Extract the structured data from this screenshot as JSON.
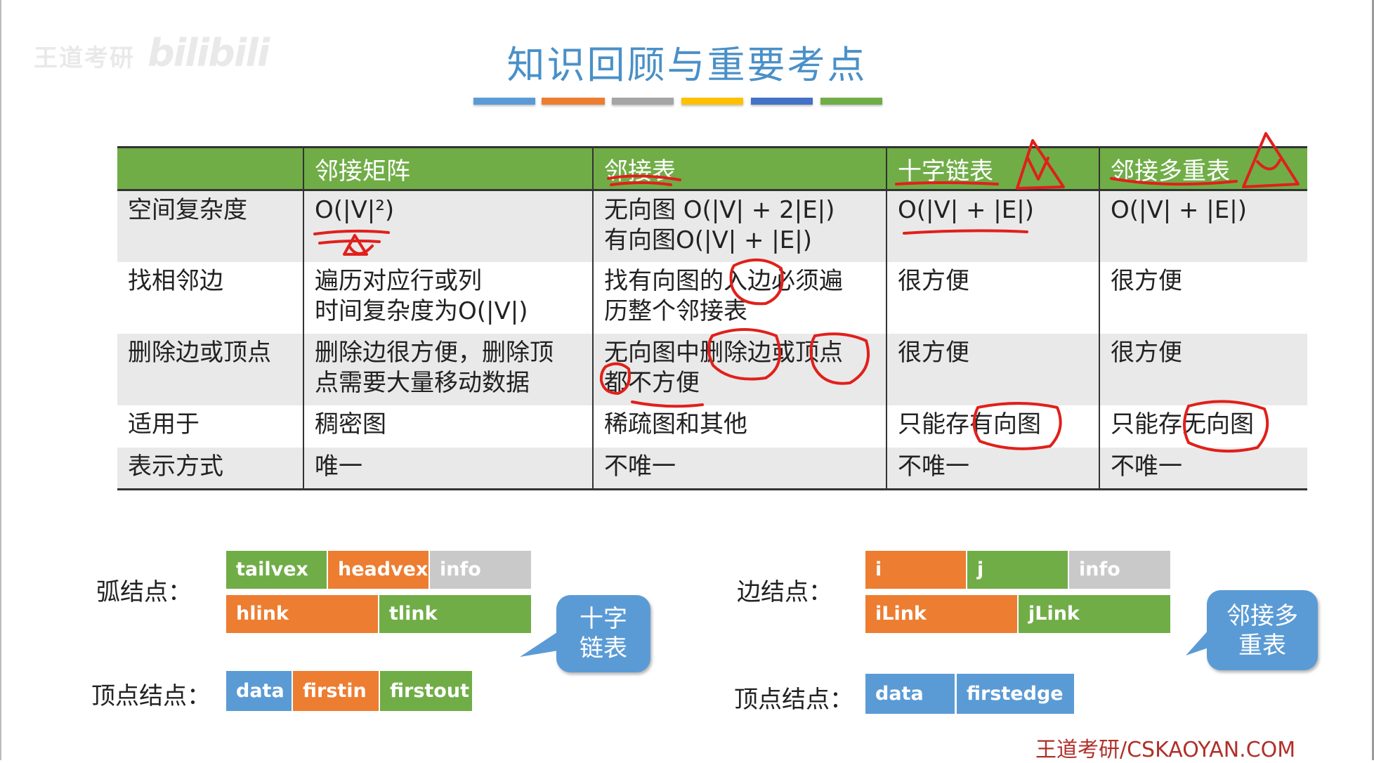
{
  "watermark": {
    "text": "王道考研",
    "brand": "bilibili"
  },
  "title": "知识回顾与重要考点",
  "title_bar_colors": [
    "#5b9bd5",
    "#ed7d31",
    "#a5a5a5",
    "#ffc000",
    "#4472c4",
    "#70ad47"
  ],
  "table": {
    "headers": [
      "",
      "邻接矩阵",
      "邻接表",
      "十字链表",
      "邻接多重表"
    ],
    "rows": [
      {
        "label": "空间复杂度",
        "cells": [
          [
            "O(|V|²)"
          ],
          [
            "无向图 O(|V| + 2|E|)",
            "有向图O(|V| + |E|)"
          ],
          [
            "O(|V| + |E|)"
          ],
          [
            "O(|V| + |E|)"
          ]
        ]
      },
      {
        "label": "找相邻边",
        "cells": [
          [
            "遍历对应行或列",
            "时间复杂度为O(|V|)"
          ],
          [
            "找有向图的入边必须遍",
            "历整个邻接表"
          ],
          [
            "很方便"
          ],
          [
            "很方便"
          ]
        ]
      },
      {
        "label": "删除边或顶点",
        "cells": [
          [
            "删除边很方便，删除顶",
            "点需要大量移动数据"
          ],
          [
            "无向图中删除边或顶点",
            "都不方便"
          ],
          [
            "很方便"
          ],
          [
            "很方便"
          ]
        ]
      },
      {
        "label": "适用于",
        "cells": [
          [
            "稠密图"
          ],
          [
            "稀疏图和其他"
          ],
          [
            "只能存有向图"
          ],
          [
            "只能存无向图"
          ]
        ]
      },
      {
        "label": "表示方式",
        "cells": [
          [
            "唯一"
          ],
          [
            "不唯一"
          ],
          [
            "不唯一"
          ],
          [
            "不唯一"
          ]
        ]
      }
    ]
  },
  "cross_list": {
    "arc_label": "弧结点：",
    "arc_row1": [
      "tailvex",
      "headvex",
      "info"
    ],
    "arc_row2": [
      "hlink",
      "tlink"
    ],
    "vertex_label": "顶点结点：",
    "vertex_fields": [
      "data",
      "firstin",
      "firstout"
    ],
    "callout_lines": [
      "十字",
      "链表"
    ]
  },
  "multi_list": {
    "edge_label": "边结点：",
    "edge_row1": [
      "i",
      "j",
      "info"
    ],
    "edge_row2": [
      "iLink",
      "jLink"
    ],
    "vertex_label": "顶点结点：",
    "vertex_fields": [
      "data",
      "firstedge"
    ],
    "callout_lines": [
      "邻接多",
      "重表"
    ]
  },
  "footer": "王道考研/CSKAOYAN.COM",
  "colors": {
    "accent_red": "#e0201b",
    "title_blue": "#4a90c8",
    "header_green": "#70ad47"
  }
}
